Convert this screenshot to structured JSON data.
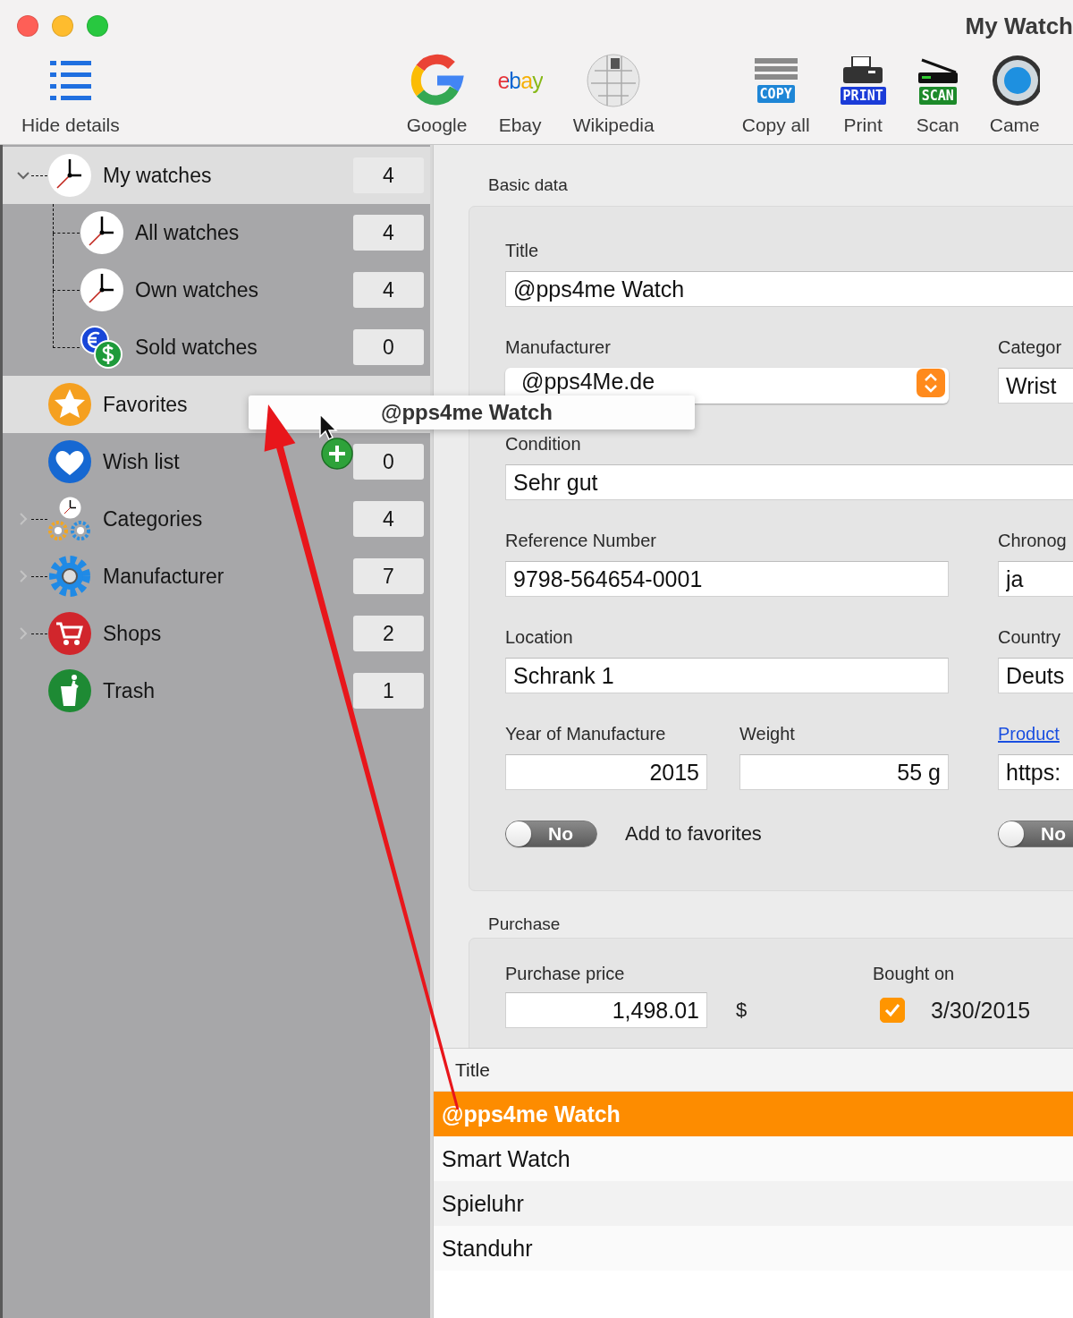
{
  "window": {
    "title": "My Watch"
  },
  "toolbar": [
    {
      "items": [
        {
          "kind": "list",
          "label": "Hide details"
        }
      ]
    },
    {
      "items": [
        {
          "kind": "google",
          "label": "Google"
        },
        {
          "kind": "ebay",
          "label": "Ebay",
          "logo": "ebay"
        },
        {
          "kind": "wikipedia",
          "label": "Wikipedia"
        }
      ]
    },
    {
      "items": [
        {
          "kind": "copy",
          "label": "Copy all",
          "badge": "COPY"
        },
        {
          "kind": "print",
          "label": "Print",
          "badge": "PRINT"
        },
        {
          "kind": "scan",
          "label": "Scan",
          "badge": "SCAN"
        },
        {
          "kind": "camera",
          "label": "Came"
        }
      ]
    }
  ],
  "sidebar": {
    "items": [
      {
        "label": "My watches",
        "count": "4",
        "kind": "clock",
        "selected": true,
        "expanded": true,
        "children": [
          {
            "label": "All watches",
            "count": "4",
            "kind": "clock",
            "selected": false
          },
          {
            "label": "Own watches",
            "count": "4",
            "kind": "clock",
            "selected": false
          },
          {
            "label": "Sold watches",
            "count": "0",
            "kind": "money",
            "selected": false
          }
        ]
      },
      {
        "label": "Favorites",
        "kind": "star",
        "selected": true
      },
      {
        "label": "Wish list",
        "count": "0",
        "kind": "heart",
        "selected": false
      },
      {
        "label": "Categories",
        "count": "4",
        "kind": "categories",
        "selected": false,
        "expanded": false
      },
      {
        "label": "Manufacturer",
        "count": "7",
        "kind": "gear",
        "selected": false,
        "expanded": false
      },
      {
        "label": "Shops",
        "count": "2",
        "kind": "cart",
        "selected": false,
        "expanded": false
      },
      {
        "label": "Trash",
        "count": "1",
        "kind": "trash",
        "selected": false
      }
    ]
  },
  "basic_data": {
    "heading": "Basic data",
    "rows": [
      {
        "wide": {
          "kind": "text",
          "label": "Title",
          "value": "@pps4me Watch"
        }
      },
      {
        "left": [
          {
            "kind": "popup",
            "label": "Manufacturer",
            "value": "@pps4Me.de"
          }
        ],
        "right": {
          "kind": "text",
          "label": "Categor",
          "value": "Wrist"
        }
      },
      {
        "wide": {
          "kind": "text",
          "label": "Condition",
          "value": "Sehr gut"
        }
      },
      {
        "left": [
          {
            "kind": "text",
            "label": "Reference Number",
            "value": "9798-564654-0001"
          }
        ],
        "right": {
          "kind": "text",
          "label": "Chronog",
          "value": "ja"
        }
      },
      {
        "left": [
          {
            "kind": "text",
            "label": "Location",
            "value": "Schrank 1"
          }
        ],
        "right": {
          "kind": "text",
          "label": "Country",
          "value": "Deuts"
        }
      },
      {
        "left": [
          {
            "kind": "number",
            "label": "Year of Manufacture",
            "value": "2015"
          },
          {
            "kind": "number",
            "label": "Weight",
            "value": "55 g"
          }
        ],
        "right": {
          "kind": "text",
          "link_label": "Product",
          "value": "https:"
        }
      },
      {
        "left": [
          {
            "kind": "toggle",
            "on": false,
            "state_text": "No",
            "label": "Add to favorites"
          }
        ],
        "right": {
          "kind": "toggle",
          "on": false,
          "state_text": "No"
        }
      }
    ]
  },
  "purchase": {
    "heading": "Purchase",
    "price_label": "Purchase price",
    "price": "1,498.01",
    "currency": "$",
    "bought_label": "Bought on",
    "bought_checked": true,
    "bought_date": "3/30/2015"
  },
  "table": {
    "columns": [
      "Title"
    ],
    "rows": [
      {
        "title": "@pps4me Watch",
        "selected": true
      },
      {
        "title": "Smart Watch",
        "selected": false
      },
      {
        "title": "Spieluhr",
        "selected": false
      },
      {
        "title": "Standuhr",
        "selected": false
      }
    ]
  },
  "drag": {
    "label": "@pps4me Watch"
  }
}
